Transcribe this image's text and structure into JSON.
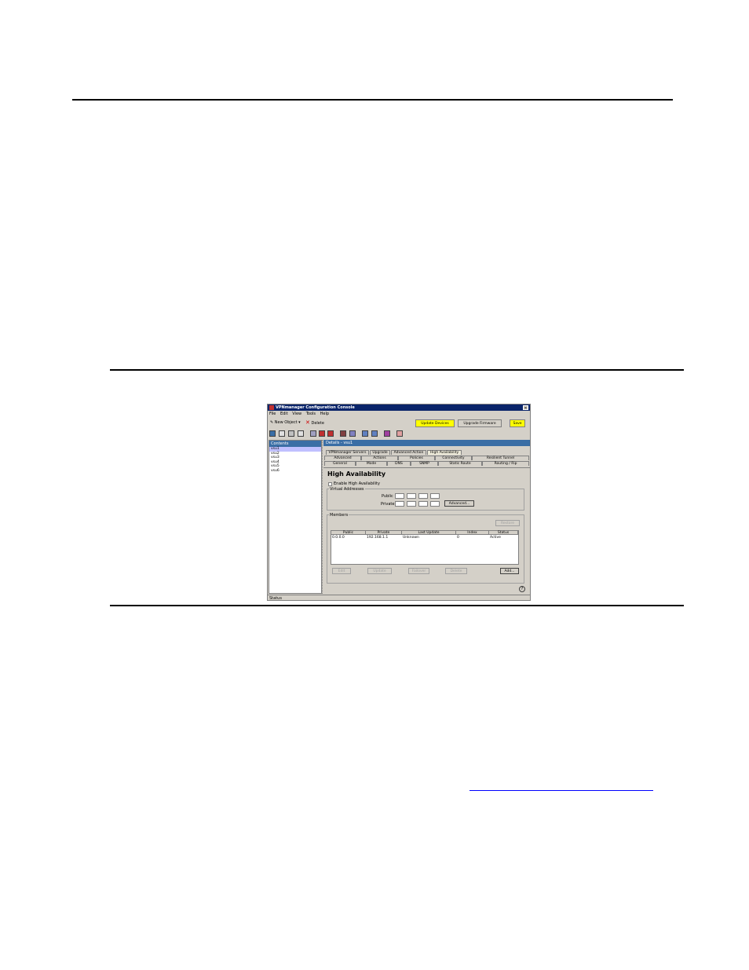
{
  "window": {
    "title": "VPNmanager Configuration Console",
    "menu": [
      "File",
      "Edit",
      "View",
      "Tools",
      "Help"
    ],
    "toolbar": {
      "new_object": "New Object",
      "delete": "Delete",
      "update_devices": "Update Devices",
      "upgrade_firmware": "Upgrade Firmware",
      "save": "Save"
    },
    "contents": {
      "header": "Contents",
      "items": [
        "vsu1",
        "vsu2",
        "vsu3",
        "vsu4",
        "vsu5",
        "vsu6"
      ],
      "selected": "vsu1"
    },
    "details": {
      "header": "Details - vsu1",
      "tabs_row1": [
        "VPNmanager Servers",
        "Upgrade",
        "Advanced Action",
        "High Availability"
      ],
      "tabs_row2": [
        "Advanced",
        "Actions",
        "Policies",
        "Connectivity",
        "Resilient Tunnel"
      ],
      "tabs_row3": [
        "General",
        "Mode",
        "DNS",
        "SNMP",
        "Static Route",
        "Routing / Rip"
      ],
      "active_tab": "High Availability",
      "panel_title": "High Availability",
      "enable_label": "Enable High Availability",
      "virtual_addresses_label": "Virtual Addresses",
      "public_label": "Public",
      "private_label": "Private",
      "advanced_button": "Advanced...",
      "members_label": "Members",
      "restore_button": "Restore",
      "columns": [
        "Public",
        "Private",
        "Last Update",
        "Index",
        "Status"
      ],
      "rows": [
        [
          "0.0.0.0",
          "192.168.1.1",
          "Unknown",
          "0",
          "Active"
        ]
      ],
      "buttons": [
        "Edit",
        "Update",
        "Failover",
        "Delete",
        "Add..."
      ]
    },
    "status": "Status"
  },
  "colors": {
    "title_bar": "#0a246a",
    "pane_header": "#3a6ea5",
    "highlight_button": "#ffff00",
    "link": "#0000ff"
  }
}
